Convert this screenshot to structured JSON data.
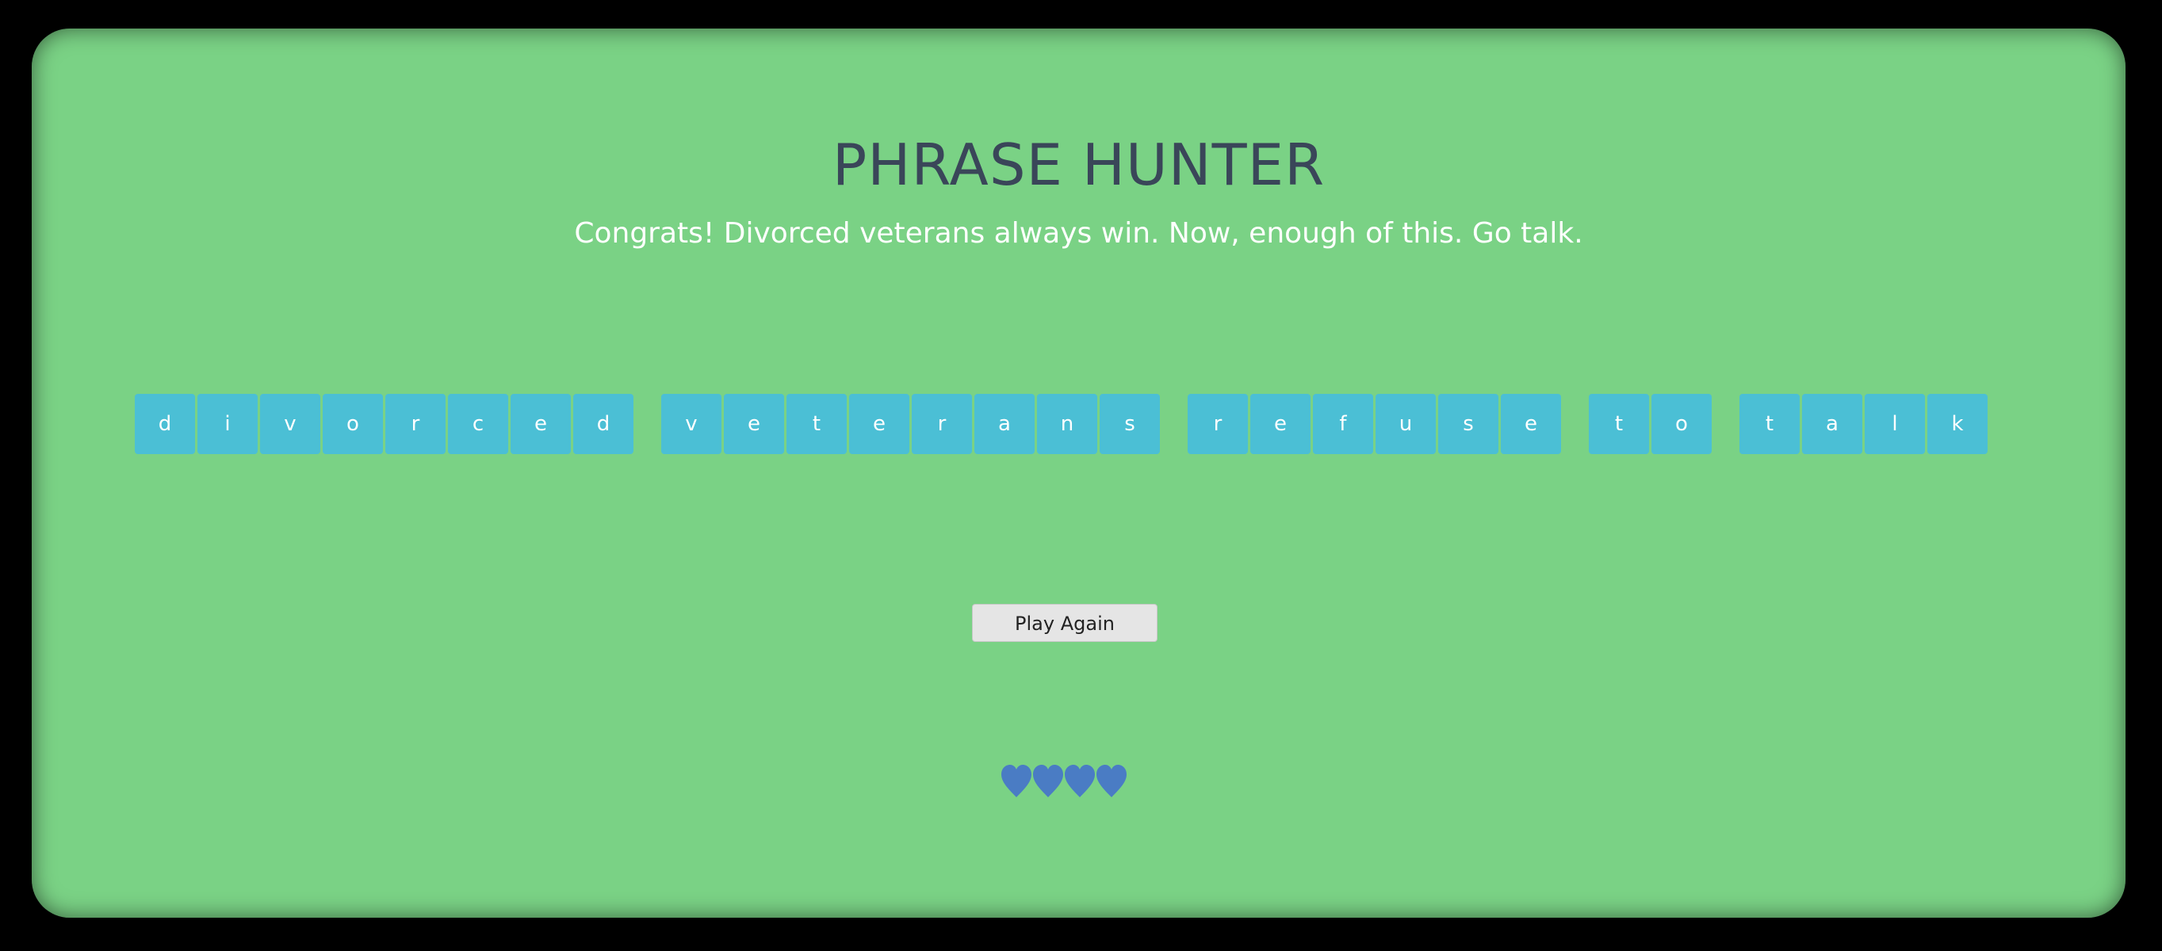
{
  "title": "PHRASE HUNTER",
  "message": "Congrats! Divorced veterans always win. Now, enough of this. Go talk.",
  "phrase": [
    {
      "letters": [
        "d",
        "i",
        "v",
        "o",
        "r",
        "c",
        "e",
        "d"
      ]
    },
    {
      "letters": [
        "v",
        "e",
        "t",
        "e",
        "r",
        "a",
        "n",
        "s"
      ]
    },
    {
      "letters": [
        "r",
        "e",
        "f",
        "u",
        "s",
        "e"
      ]
    },
    {
      "letters": [
        "t",
        "o"
      ]
    },
    {
      "letters": [
        "t",
        "a",
        "l",
        "k"
      ]
    }
  ],
  "play_again_label": "Play Again",
  "lives": {
    "remaining": 4,
    "total": 4,
    "icon": "heart-icon",
    "color": "#4a7cc4"
  },
  "colors": {
    "background": "#7ad285",
    "letter_tile": "#4bbfd5",
    "title": "#3a4659"
  }
}
